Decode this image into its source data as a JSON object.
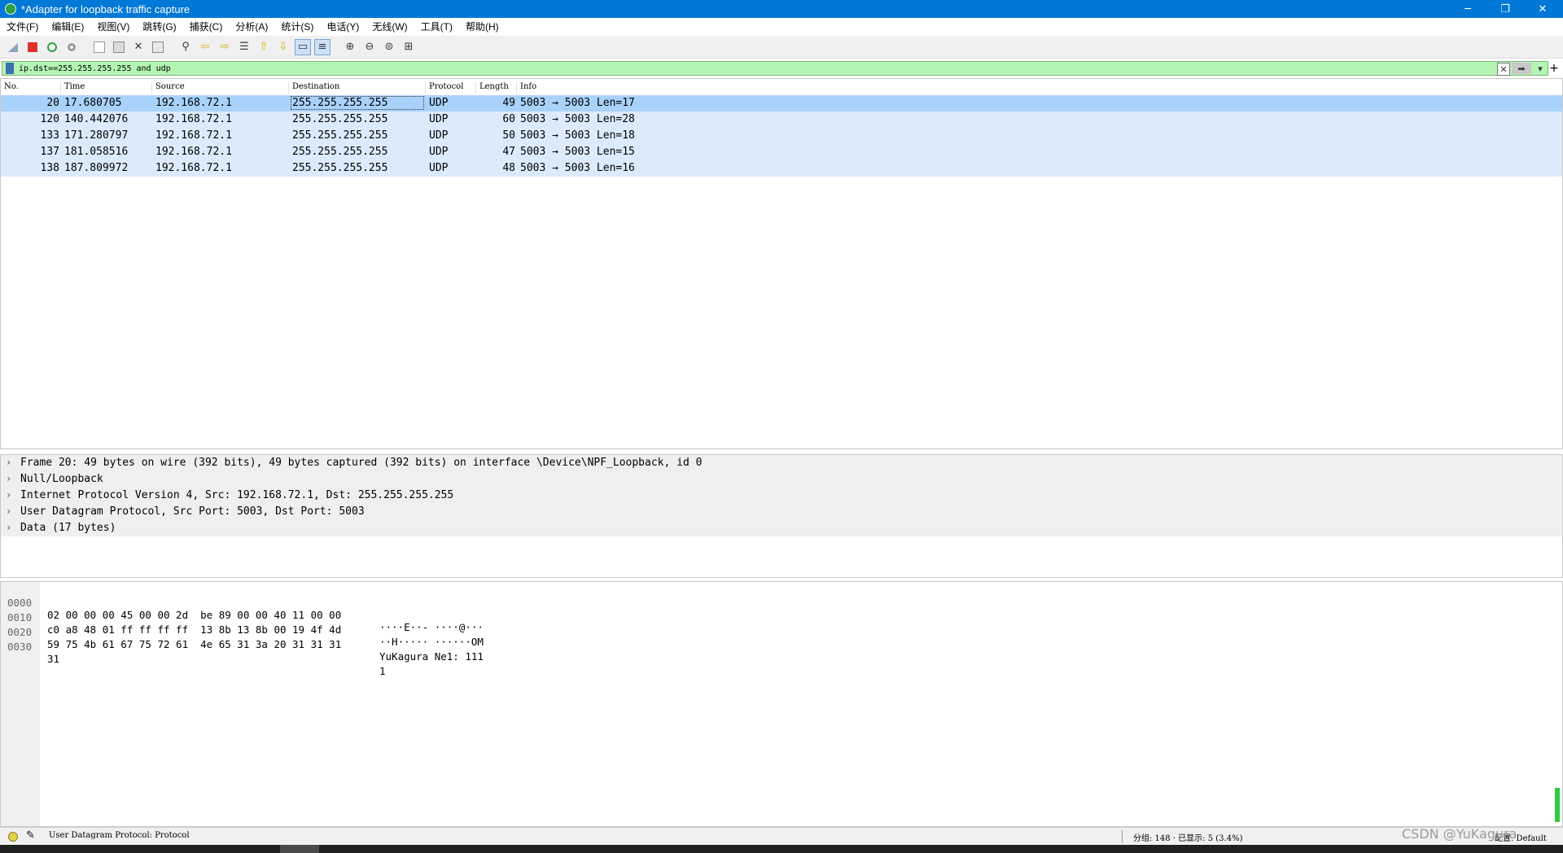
{
  "window": {
    "title": "*Adapter for loopback traffic capture",
    "controls": [
      "─",
      "❐",
      "✕"
    ]
  },
  "menu": [
    "文件(F)",
    "编辑(E)",
    "视图(V)",
    "跳转(G)",
    "捕获(C)",
    "分析(A)",
    "统计(S)",
    "电话(Y)",
    "无线(W)",
    "工具(T)",
    "帮助(H)"
  ],
  "toolbar": {
    "icons": [
      "shark-fin-icon",
      "stop-capture-icon",
      "restart-capture-icon",
      "capture-options-icon",
      "open-file-icon",
      "save-file-icon",
      "close-file-icon",
      "reload-file-icon",
      "find-packet-icon",
      "go-back-icon",
      "go-forward-icon",
      "go-to-packet-icon",
      "first-packet-icon",
      "last-packet-icon",
      "autoscroll-icon",
      "colorize-icon",
      "zoom-in-icon",
      "zoom-out-icon",
      "normal-size-icon",
      "resize-columns-icon"
    ]
  },
  "filter": {
    "value": "ip.dst==255.255.255.255 and udp",
    "bg_color": "#b3f5b3"
  },
  "packet_list": {
    "columns": [
      "No.",
      "Time",
      "Source",
      "Destination",
      "Protocol",
      "Length",
      "Info"
    ],
    "rows": [
      {
        "no": "20",
        "time": "17.680705",
        "source": "192.168.72.1",
        "destination": "255.255.255.255",
        "protocol": "UDP",
        "length": "49",
        "info": "5003 → 5003 Len=17"
      },
      {
        "no": "120",
        "time": "140.442076",
        "source": "192.168.72.1",
        "destination": "255.255.255.255",
        "protocol": "UDP",
        "length": "60",
        "info": "5003 → 5003 Len=28"
      },
      {
        "no": "133",
        "time": "171.280797",
        "source": "192.168.72.1",
        "destination": "255.255.255.255",
        "protocol": "UDP",
        "length": "50",
        "info": "5003 → 5003 Len=18"
      },
      {
        "no": "137",
        "time": "181.058516",
        "source": "192.168.72.1",
        "destination": "255.255.255.255",
        "protocol": "UDP",
        "length": "47",
        "info": "5003 → 5003 Len=15"
      },
      {
        "no": "138",
        "time": "187.809972",
        "source": "192.168.72.1",
        "destination": "255.255.255.255",
        "protocol": "UDP",
        "length": "48",
        "info": "5003 → 5003 Len=16"
      }
    ],
    "selected_index": 0,
    "row_color": "#dcebfc",
    "selected_color": "#a9d2fb"
  },
  "details": [
    "Frame 20: 49 bytes on wire (392 bits), 49 bytes captured (392 bits) on interface \\Device\\NPF_Loopback, id 0",
    "Null/Loopback",
    "Internet Protocol Version 4, Src: 192.168.72.1, Dst: 255.255.255.255",
    "User Datagram Protocol, Src Port: 5003, Dst Port: 5003",
    "Data (17 bytes)"
  ],
  "bytes": [
    {
      "offset": "0000",
      "hex": "02 00 00 00 45 00 00 2d  be 89 00 00 40 11 00 00",
      "ascii": "····E··- ····@···"
    },
    {
      "offset": "0010",
      "hex": "c0 a8 48 01 ff ff ff ff  13 8b 13 8b 00 19 4f 4d",
      "ascii": "··H····· ······OM"
    },
    {
      "offset": "0020",
      "hex": "59 75 4b 61 67 75 72 61  4e 65 31 3a 20 31 31 31",
      "ascii": "YuKagura Ne1: 111"
    },
    {
      "offset": "0030",
      "hex": "31",
      "ascii": "1"
    }
  ],
  "status": {
    "field": "User Datagram Protocol: Protocol",
    "packets": "分组: 148 · 已显示: 5 (3.4%)",
    "profile": "配置: Default",
    "led_color": "#e3d34a"
  },
  "watermark": "CSDN @YuKagura"
}
